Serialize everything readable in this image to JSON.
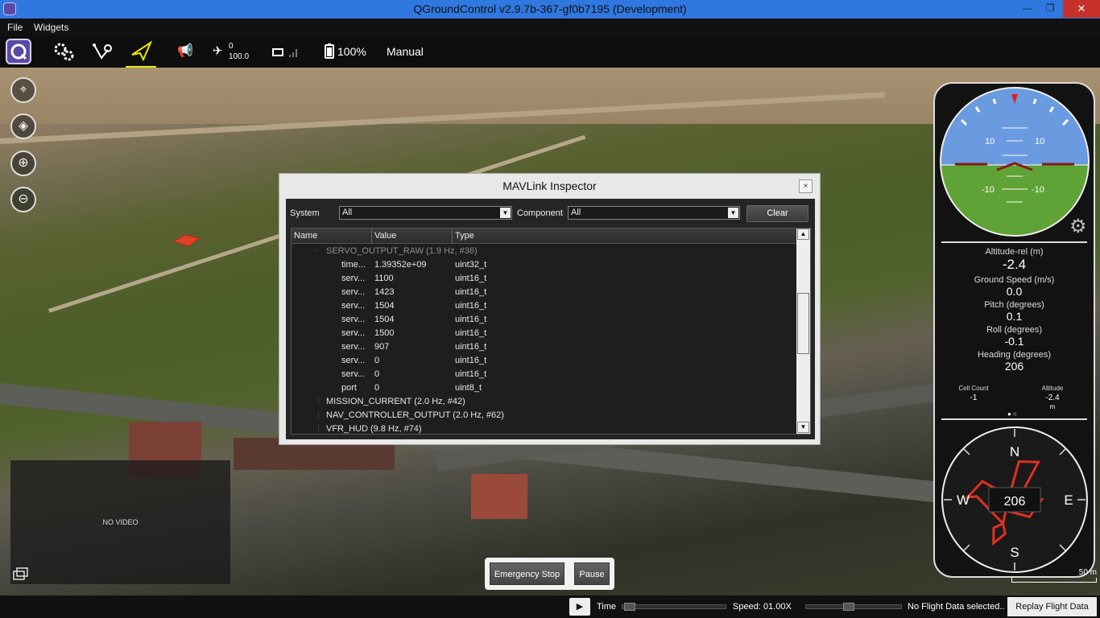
{
  "window": {
    "title": "QGroundControl v2.9.7b-367-gf0b7195 (Development)",
    "minimize": "—",
    "maximize": "❐",
    "close": "✕"
  },
  "menu": {
    "file": "File",
    "widgets": "Widgets"
  },
  "toolbar": {
    "gps_count": "0",
    "gps_hdop": "100.0",
    "battery": "100%",
    "flight_mode": "Manual",
    "accent": "#e8e800"
  },
  "map_buttons": [
    {
      "icon": "center-icon",
      "glyph": "⌖"
    },
    {
      "icon": "layers-icon",
      "glyph": "◈"
    },
    {
      "icon": "zoom-in-icon",
      "glyph": "⊕"
    },
    {
      "icon": "zoom-out-icon",
      "glyph": "⊖"
    }
  ],
  "video": {
    "label": "NO VIDEO"
  },
  "inspector": {
    "title": "MAVLink Inspector",
    "close": "×",
    "system_label": "System",
    "system_value": "All",
    "component_label": "Component",
    "component_value": "All",
    "clear": "Clear",
    "columns": [
      "Name",
      "Value",
      "Type"
    ],
    "rows": [
      {
        "name": "SERVO_OUTPUT_RAW (1.9 Hz, #36)",
        "value": "",
        "type": "",
        "level": 0,
        "expanded": true
      },
      {
        "name": "time...",
        "value": "1.39352e+09",
        "type": "uint32_t",
        "level": 1
      },
      {
        "name": "serv...",
        "value": "1100",
        "type": "uint16_t",
        "level": 1
      },
      {
        "name": "serv...",
        "value": "1423",
        "type": "uint16_t",
        "level": 1
      },
      {
        "name": "serv...",
        "value": "1504",
        "type": "uint16_t",
        "level": 1
      },
      {
        "name": "serv...",
        "value": "1504",
        "type": "uint16_t",
        "level": 1
      },
      {
        "name": "serv...",
        "value": "1500",
        "type": "uint16_t",
        "level": 1
      },
      {
        "name": "serv...",
        "value": "907",
        "type": "uint16_t",
        "level": 1
      },
      {
        "name": "serv...",
        "value": "0",
        "type": "uint16_t",
        "level": 1
      },
      {
        "name": "serv...",
        "value": "0",
        "type": "uint16_t",
        "level": 1
      },
      {
        "name": "port",
        "value": "0",
        "type": "uint8_t",
        "level": 1
      },
      {
        "name": "MISSION_CURRENT (2.0 Hz, #42)",
        "value": "",
        "type": "",
        "level": 0
      },
      {
        "name": "NAV_CONTROLLER_OUTPUT (2.0 Hz, #62)",
        "value": "",
        "type": "",
        "level": 0
      },
      {
        "name": "VFR_HUD (9.8 Hz, #74)",
        "value": "",
        "type": "",
        "level": 0
      }
    ]
  },
  "instrument": {
    "attitude_ticks": {
      "up_left": "10",
      "up_right": "10",
      "down_left": "-10",
      "down_right": "-10"
    },
    "values": [
      {
        "label": "Altitude-rel (m)",
        "value": "-2.4"
      },
      {
        "label": "Ground Speed (m/s)",
        "value": "0.0"
      },
      {
        "label": "Pitch (degrees)",
        "value": "0.1"
      },
      {
        "label": "Roll (degrees)",
        "value": "-0.1"
      },
      {
        "label": "Heading (degrees)",
        "value": "206"
      }
    ],
    "cell_count_label": "Cell Count",
    "cell_count_value": "-1",
    "altitude_label": "Altitude",
    "altitude_value": "-2.4",
    "altitude_unit": "m",
    "compass": {
      "n": "N",
      "e": "E",
      "s": "S",
      "w": "W",
      "heading": "206"
    },
    "scale": "50 m"
  },
  "controls": {
    "emergency_stop": "Emergency Stop",
    "pause": "Pause"
  },
  "status": {
    "time_label": "Time",
    "speed": "Speed: 01.00X",
    "no_data": "No Flight Data selected..",
    "replay": "Replay Flight Data",
    "play": "▶"
  }
}
